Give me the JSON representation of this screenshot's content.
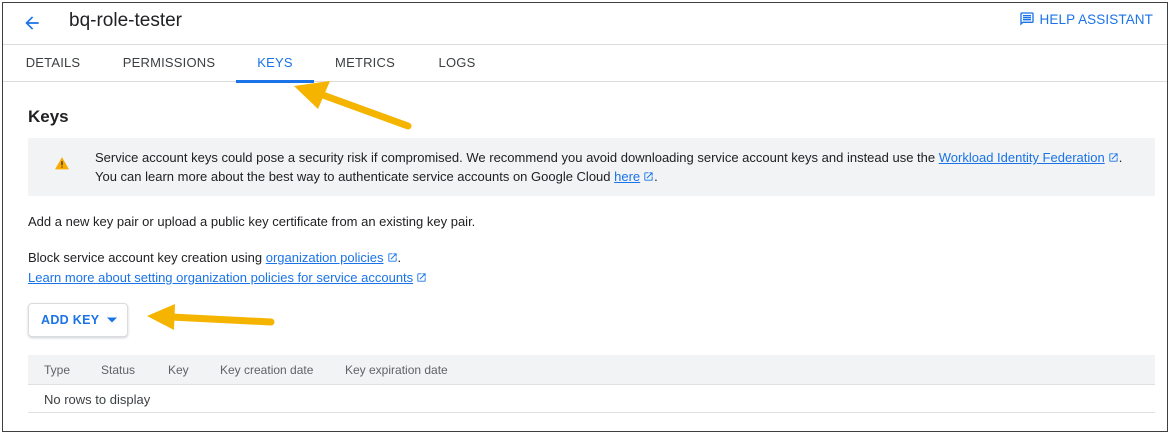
{
  "header": {
    "title": "bq-role-tester",
    "help_label": "HELP ASSISTANT"
  },
  "tabs": [
    {
      "label": "DETAILS",
      "active": false
    },
    {
      "label": "PERMISSIONS",
      "active": false
    },
    {
      "label": "KEYS",
      "active": true
    },
    {
      "label": "METRICS",
      "active": false
    },
    {
      "label": "LOGS",
      "active": false
    }
  ],
  "keys": {
    "title": "Keys",
    "banner": {
      "line1_text": "Service account keys could pose a security risk if compromised. We recommend you avoid downloading service account keys and instead use the ",
      "line1_link": "Workload Identity Federation",
      "line1_end": ".",
      "line2_text": "You can learn more about the best way to authenticate service accounts on Google Cloud ",
      "line2_link": "here",
      "line2_end": "."
    },
    "intro": "Add a new key pair or upload a public key certificate from an existing key pair.",
    "block_text": "Block service account key creation using ",
    "block_link": "organization policies",
    "block_end": ".",
    "learn_link": "Learn more about setting organization policies for service accounts",
    "add_key_label": "ADD KEY",
    "table": {
      "columns": [
        "Type",
        "Status",
        "Key",
        "Key creation date",
        "Key expiration date"
      ],
      "empty_text": "No rows to display"
    }
  },
  "icons": {
    "back": "arrow-back-icon",
    "help": "feedback-icon",
    "warning": "warning-icon",
    "external": "open-in-new-icon",
    "dropdown": "caret-down-icon"
  },
  "colors": {
    "accent": "#1a73e8",
    "warning": "#f9ab00",
    "annotation_arrow": "#f5b400"
  }
}
